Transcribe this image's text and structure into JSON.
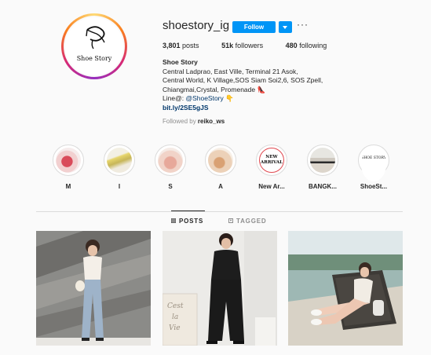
{
  "profile": {
    "logo_text": "Shoe Story",
    "username": "shoestory_ig",
    "follow_label": "Follow",
    "more_label": "···",
    "stats": {
      "posts_count": "3,801",
      "posts_label": "posts",
      "followers_count": "51k",
      "followers_label": "followers",
      "following_count": "480",
      "following_label": "following"
    },
    "bio": {
      "name": "Shoe Story",
      "line1": "Central Ladprao, East Ville, Terminal 21 Asok,",
      "line2": "Central World, K Village,SOS Siam Soi2,6, SOS Zpell,",
      "line3": "Chiangmai,Crystal, Promenade 👠",
      "line4_prefix": "Line@: ",
      "line4_mention": "@ShoeStory",
      "line4_emoji": "👇",
      "link": "bit.ly/2SE5gJS"
    },
    "followed_by_prefix": "Followed by ",
    "followed_by_user": "reiko_ws"
  },
  "highlights": [
    {
      "label": "M"
    },
    {
      "label": "I"
    },
    {
      "label": "S"
    },
    {
      "label": "A"
    },
    {
      "label": "New Ar...",
      "badge_line1": "NEW",
      "badge_line2": "ARRIVAL"
    },
    {
      "label": "BANGK..."
    },
    {
      "label": "ShoeSt...",
      "badge_line1": "SHOE STORY"
    }
  ],
  "tabs": {
    "posts": "POSTS",
    "tagged": "TAGGED"
  },
  "posts": [
    {
      "kind": "photo"
    },
    {
      "kind": "photo",
      "overlay_text": "Cest la Vie"
    },
    {
      "kind": "photo"
    }
  ],
  "colors": {
    "accent": "#0095f6",
    "text": "#262626",
    "muted": "#8e8e8e",
    "link": "#00376b"
  }
}
